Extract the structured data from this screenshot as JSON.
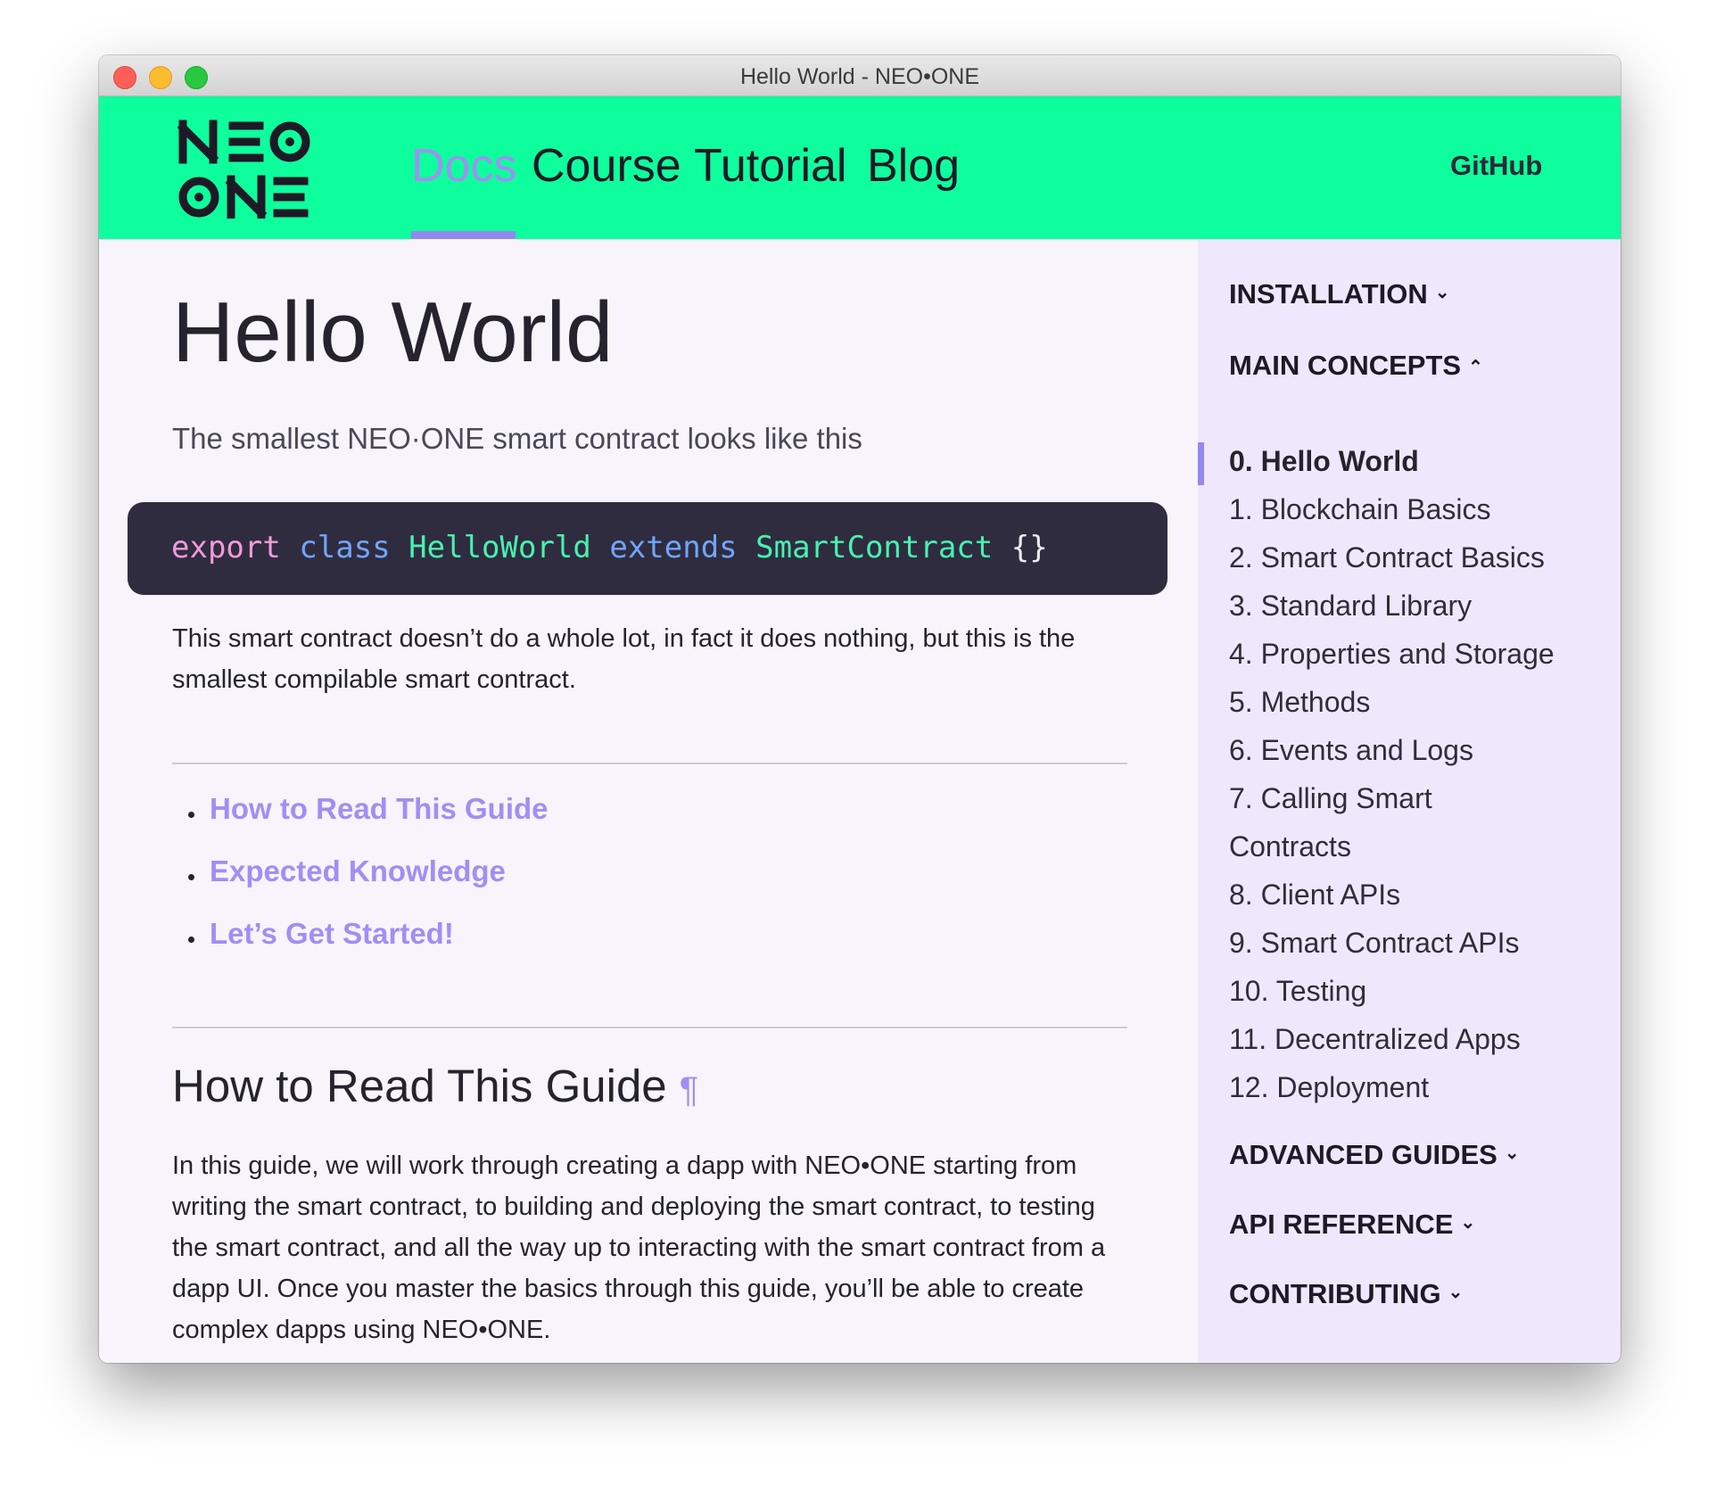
{
  "window": {
    "title": "Hello World - NEO•ONE"
  },
  "nav": {
    "logo_text": "NEO ONE",
    "links": [
      "Docs",
      "Course",
      "Tutorial",
      "Blog"
    ],
    "github": "GitHub"
  },
  "colors": {
    "nav_bg": "#0ffe9d",
    "accent": "#a08ff2",
    "code_bg": "#302c3f",
    "sidebar_bg": "#efe7fc",
    "text": "#25232e"
  },
  "main": {
    "title": "Hello World",
    "intro": "The smallest NEO·ONE smart contract looks like this",
    "code": {
      "export": "export",
      "class": "class",
      "name": "HelloWorld",
      "extends": "extends",
      "parent": "SmartContract",
      "braces": "{}"
    },
    "para1": "This smart contract doesn’t do a whole lot, in fact it does nothing, but this is the smallest compilable smart contract.",
    "toc": [
      "How to Read This Guide",
      "Expected Knowledge",
      "Let’s Get Started!"
    ],
    "section_title": "How to Read This Guide",
    "pilcrow": "¶",
    "para2": "In this guide, we will work through creating a dapp with NEO•ONE starting from writing the smart contract, to building and deploying the smart contract, to testing the smart contract, and all the way up to interacting with the smart contract from a dapp UI. Once you master the basics through this guide, you’ll be able to create complex dapps using NEO•ONE."
  },
  "sidebar": {
    "installation": "INSTALLATION",
    "main_concepts": "MAIN CONCEPTS",
    "items": [
      "0. Hello World",
      "1. Blockchain Basics",
      "2. Smart Contract Basics",
      "3. Standard Library",
      "4. Properties and Storage",
      "5. Methods",
      "6. Events and Logs",
      "7. Calling Smart",
      "Contracts",
      "8. Client APIs",
      "9. Smart Contract APIs",
      "10. Testing",
      "11. Decentralized Apps",
      "12. Deployment"
    ],
    "advanced_guides": "ADVANCED GUIDES",
    "api_reference": "API REFERENCE",
    "contributing": "CONTRIBUTING"
  }
}
